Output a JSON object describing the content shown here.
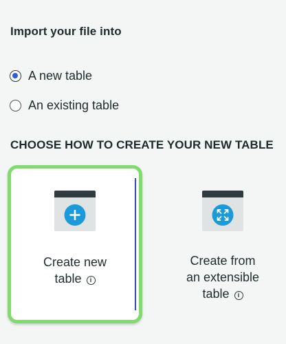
{
  "import_section": {
    "title": "Import your file into",
    "options": [
      {
        "label": "A new table",
        "selected": true
      },
      {
        "label": "An existing table",
        "selected": false
      }
    ]
  },
  "create_section": {
    "heading": "CHOOSE HOW TO CREATE YOUR NEW TABLE",
    "cards": [
      {
        "line1": "Create new",
        "line2": "table",
        "icon": "plus-icon",
        "selected": true
      },
      {
        "line1": "Create from",
        "line2": "an extensible",
        "line3": "table",
        "icon": "expand-arrows-icon",
        "selected": false
      }
    ]
  },
  "colors": {
    "accent": "#2f5bd8",
    "selected_border": "#7fdc6c",
    "icon_circle": "#1a9ad8",
    "icon_bar": "#2f3b3e"
  }
}
